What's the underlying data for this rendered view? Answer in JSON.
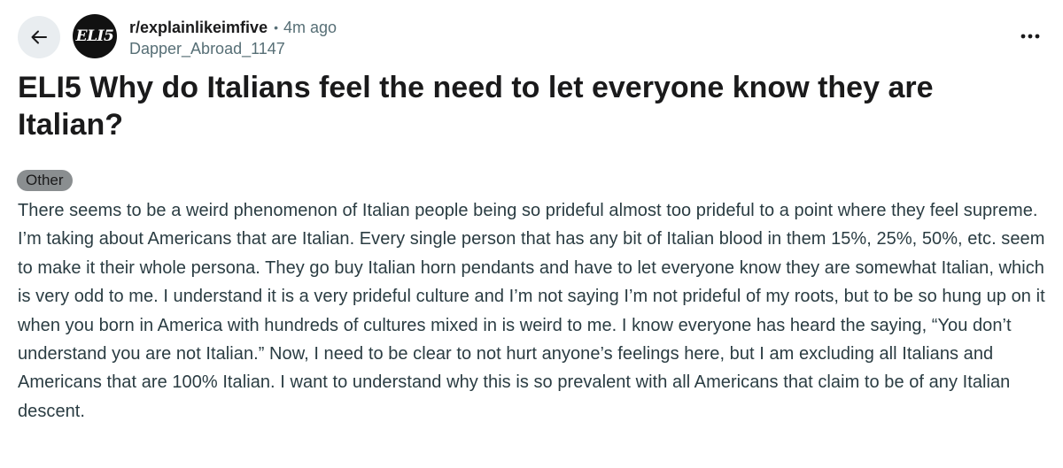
{
  "header": {
    "subreddit": "r/explainlikeimfive",
    "separator": "•",
    "time_ago": "4m ago",
    "username": "Dapper_Abroad_1147",
    "avatar_text": "ELI5"
  },
  "post": {
    "title": "ELI5 Why do Italians feel the need to let everyone know they are Italian?",
    "flair": "Other",
    "body": "There seems to be a weird phenomenon of Italian people being so prideful almost too prideful to a point where they feel supreme. I’m taking about Americans that are Italian. Every single person that has any bit of Italian blood in them 15%, 25%, 50%, etc. seem to make it their whole persona. They go buy Italian horn pendants and have to let everyone know they are somewhat Italian, which is very odd to me. I understand it is a very prideful culture and I’m not saying I’m not prideful of my roots, but to be so hung up on it when you born in America with hundreds of cultures mixed in is weird to me. I know everyone has heard the saying, “You don’t understand you are not Italian.” Now, I need to be clear to not hurt anyone’s feelings here, but I am excluding all Italians and Americans that are 100% Italian. I want to understand why this is so prevalent with all Americans that claim to be of any Italian descent."
  },
  "icons": {
    "back": "arrow-left-icon",
    "more": "more-horizontal-icon"
  },
  "colors": {
    "back_button_bg": "#e9edf0",
    "flair_bg": "#8a8e90",
    "meta_gray": "#576f76",
    "title": "#1a1a1b",
    "body": "#2a3c42"
  }
}
